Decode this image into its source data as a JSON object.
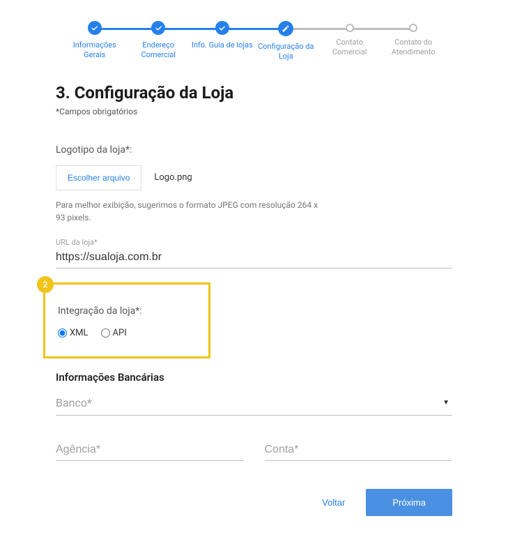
{
  "stepper": {
    "steps": [
      {
        "label": "Informações Gerais",
        "state": "done"
      },
      {
        "label": "Endereço Comercial",
        "state": "done"
      },
      {
        "label": "Info. Guia de lojas",
        "state": "done"
      },
      {
        "label": "Configuração da Loja",
        "state": "current"
      },
      {
        "label": "Contato Comercial",
        "state": "pending"
      },
      {
        "label": "Contato do Atendimento",
        "state": "pending"
      }
    ]
  },
  "heading": "3. Configuração da Loja",
  "required_note": "*Campos obrigatórios",
  "logo": {
    "label": "Logotipo da loja*:",
    "button": "Escolher arquivo",
    "filename": "Logo.png",
    "hint": "Para melhor exibição, sugerimos o formato JPEG com resolução 264 x 93 pixels."
  },
  "url": {
    "label": "URL da loja*",
    "value": "https://sualoja.com.br"
  },
  "highlight_marker": "2",
  "integration": {
    "label": "Integração da loja*:",
    "options": {
      "xml": "XML",
      "api": "API"
    },
    "selected": "xml"
  },
  "bank": {
    "title": "Informações Bancárias",
    "bank_placeholder": "Banco*",
    "agency_placeholder": "Agência*",
    "account_placeholder": "Conta*"
  },
  "actions": {
    "back": "Voltar",
    "next": "Próxima"
  }
}
